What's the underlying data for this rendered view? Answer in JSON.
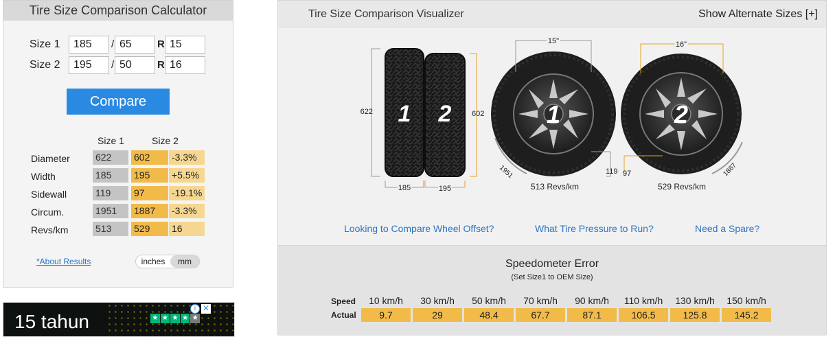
{
  "calculator": {
    "title": "Tire Size Comparison Calculator",
    "size1": {
      "label": "Size 1",
      "width": "185",
      "aspect": "65",
      "rim": "15"
    },
    "size2": {
      "label": "Size 2",
      "width": "195",
      "aspect": "50",
      "rim": "16"
    },
    "slash": "/",
    "rim_prefix": "R",
    "compare_label": "Compare",
    "results_headers": {
      "size1": "Size 1",
      "size2": "Size 2"
    },
    "results": [
      {
        "label": "Diameter",
        "size1": "622",
        "size2": "602",
        "diff": "-3.3%"
      },
      {
        "label": "Width",
        "size1": "185",
        "size2": "195",
        "diff": "+5.5%"
      },
      {
        "label": "Sidewall",
        "size1": "119",
        "size2": "97",
        "diff": "-19.1%"
      },
      {
        "label": "Circum.",
        "size1": "1951",
        "size2": "1887",
        "diff": "-3.3%"
      },
      {
        "label": "Revs/km",
        "size1": "513",
        "size2": "529",
        "diff": "16"
      }
    ],
    "about_link": "*About Results",
    "units": {
      "inches": "inches",
      "mm": "mm",
      "selected": "mm"
    }
  },
  "ad": {
    "text": "15 tahun",
    "stars": 5,
    "info_icon": "info-icon",
    "close_icon": "close-icon"
  },
  "visualizer": {
    "title": "Tire Size Comparison Visualizer",
    "alt_sizes": "Show Alternate Sizes [+]",
    "tread": {
      "tire1": {
        "num": "1",
        "height": "622",
        "width": "185"
      },
      "tire2": {
        "num": "2",
        "height": "602",
        "width": "195"
      }
    },
    "wheels": {
      "wheel1": {
        "num": "1",
        "rim": "15\"",
        "sidewall": "119",
        "circ": "1951",
        "revs": "513 Revs/km"
      },
      "wheel2": {
        "num": "2",
        "rim": "16\"",
        "sidewall": "97",
        "circ": "1887",
        "revs": "529 Revs/km"
      }
    },
    "links": [
      "Looking to Compare Wheel Offset?",
      "What Tire Pressure to Run?",
      "Need a Spare?"
    ]
  },
  "speedometer": {
    "title": "Speedometer Error",
    "subtitle": "(Set Size1 to OEM Size)",
    "speed_label": "Speed",
    "actual_label": "Actual",
    "speeds": [
      "10 km/h",
      "30 km/h",
      "50 km/h",
      "70 km/h",
      "90 km/h",
      "110 km/h",
      "130 km/h",
      "150 km/h"
    ],
    "actual": [
      "9.7",
      "29",
      "48.4",
      "67.7",
      "87.1",
      "106.5",
      "125.8",
      "145.2"
    ]
  },
  "colors": {
    "accent_blue": "#2a8ae2",
    "size2_orange": "#f2bb49",
    "diff_light": "#f6d791",
    "guide_line": "#e5a21e"
  }
}
